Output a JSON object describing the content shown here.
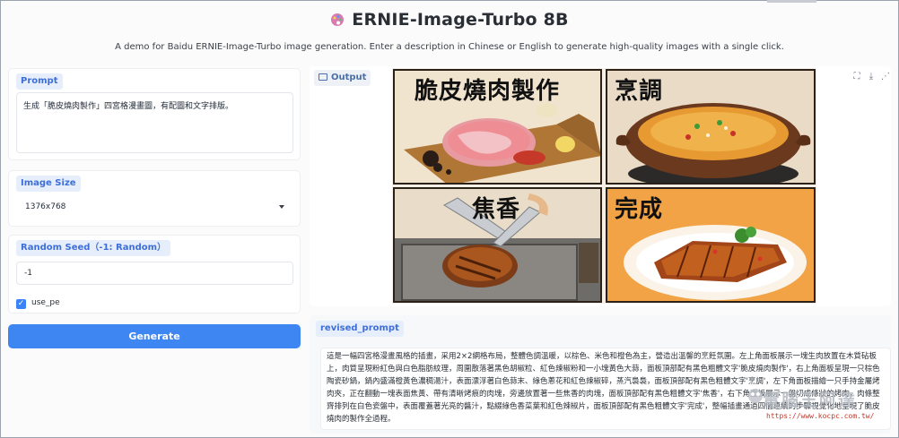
{
  "header": {
    "icon": "palette-icon",
    "title": "ERNIE-Image-Turbo 8B",
    "subtitle": "A demo for Baidu ERNIE-Image-Turbo image generation. Enter a description in Chinese or English to generate high-quality images with a single click."
  },
  "prompt": {
    "label": "Prompt",
    "value": "生成「脆皮燒肉製作」四宮格漫畫圖，有配圖和文字排版。"
  },
  "image_size": {
    "label": "Image Size",
    "value": "1376x768"
  },
  "seed": {
    "label": "Random Seed（-1: Random）",
    "value": "-1"
  },
  "use_pe": {
    "label": "use_pe",
    "checked": true
  },
  "generate_button": "Generate",
  "output": {
    "label": "Output",
    "panels": [
      {
        "caption": "脆皮燒肉製作"
      },
      {
        "caption": "烹調"
      },
      {
        "caption": "焦香"
      },
      {
        "caption": "完成"
      }
    ]
  },
  "revised_prompt": {
    "label": "revised_prompt",
    "value": "這是一幅四宮格漫畫風格的插畫，采用2×2網格布局，整體色調溫暖，以棕色、米色和橙色為主，營造出溫馨的烹飪氛圍。左上角面板展示一塊生肉放置在木質砧板上，肉質呈現粉紅色與白色脂肪紋理，周圍散落著黑色胡椒粒、紅色辣椒粉和一小塊黃色大蒜，面板頂部配有黑色粗體文字'脆皮燒肉製作'，右上角面板呈現一只棕色陶瓷砂鍋，鍋內盛滿橙黃色濃稠湯汁，表面漂浮著白色蒜末、綠色蔥花和紅色辣椒碎，蒸汽裊裊，面板頂部配有黑色粗體文字'烹調'，左下角面板描繪一只手持金屬烤肉夾，正在翻動一塊表面焦黃、帶有清晰烤痕的肉塊，旁邊放置著一些焦香的肉塊，面板頂部配有黑色粗體文字'焦香'，右下角面板展示一盤切成條狀的烤肉，肉條整齊排列在白色瓷盤中，表面覆蓋著光亮的醬汁，點綴綠色香菜葉和紅色辣椒片，面板頂部配有黑色粗體文字'完成'，整幅插畫通過四個連續的步驟視覺化地呈現了脆皮燒肉的製作全過程。"
  },
  "watermark": {
    "text": "電腦王阿達",
    "url": "https://www.kocpc.com.tw/"
  },
  "colors": {
    "accent": "#3e86f2",
    "label_bg": "#e6eefc",
    "label_text": "#3e6fd8"
  }
}
